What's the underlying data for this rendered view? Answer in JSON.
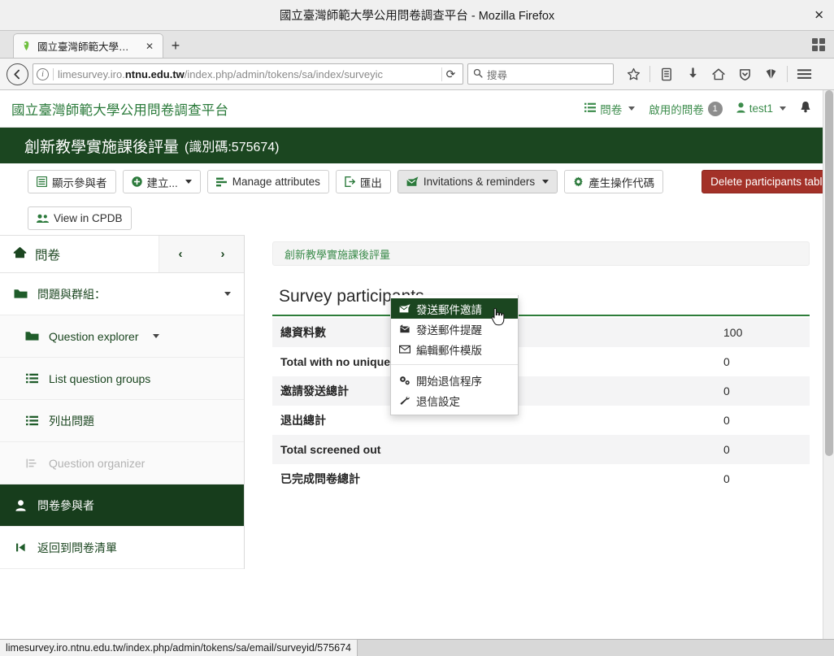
{
  "browser": {
    "window_title": "國立臺灣師範大學公用問卷調查平台 - Mozilla Firefox",
    "close_label": "✕",
    "tab_label": "國立臺灣師範大學公…",
    "tab_close": "✕",
    "new_tab": "+",
    "url_prefix": "limesurvey.iro.",
    "url_domain": "ntnu.edu.tw",
    "url_path": "/index.php/admin/tokens/sa/index/surveyic",
    "reload_glyph": "⟳",
    "search_placeholder": "搜尋",
    "search_icon": "search-icon",
    "status_url": "limesurvey.iro.ntnu.edu.tw/index.php/admin/tokens/sa/email/surveyid/575674"
  },
  "app": {
    "brand": "國立臺灣師範大學公用問卷調查平台",
    "nav": {
      "surveys_label": "問卷",
      "active_surveys_label": "啟用的問卷",
      "active_surveys_count": "1",
      "user_label": "test1",
      "bell_icon": "bell-icon"
    },
    "survey_bar": {
      "title": "創新教學實施課後評量",
      "code": "(識別碼:575674)"
    }
  },
  "toolbar": {
    "buttons": [
      {
        "label": "顯示參與者",
        "icon": "list-icon",
        "style": "default"
      },
      {
        "label": "建立...",
        "icon": "plus-circle-icon",
        "style": "default",
        "caret": true
      },
      {
        "label": "Manage attributes",
        "icon": "attributes-icon",
        "style": "default"
      },
      {
        "label": "匯出",
        "icon": "export-icon",
        "style": "default"
      },
      {
        "label": "Invitations & reminders",
        "icon": "mail-send-icon",
        "style": "active",
        "caret": true
      },
      {
        "label": "產生操作代碼",
        "icon": "gear-icon",
        "style": "default"
      },
      {
        "label": "View in CPDB",
        "icon": "users-icon",
        "style": "default"
      }
    ],
    "danger_button": {
      "label": "Delete participants table",
      "style": "danger"
    }
  },
  "dropdown": {
    "items": [
      {
        "label": "發送郵件邀請",
        "icon": "envelope-open-icon",
        "selected": true
      },
      {
        "label": "發送郵件提醒",
        "icon": "envelope-reply-icon",
        "selected": false
      },
      {
        "label": "編輯郵件模版",
        "icon": "envelope-icon",
        "selected": false
      },
      {
        "label": "開始退信程序",
        "icon": "cogs-icon",
        "selected": false,
        "after_separator": true
      },
      {
        "label": "退信設定",
        "icon": "wrench-icon",
        "selected": false
      }
    ]
  },
  "sidebar": {
    "header": {
      "label": "問卷",
      "icon": "home-icon",
      "prev": "‹",
      "next": "›"
    },
    "items": [
      {
        "label": "問題與群組：",
        "icon": "folder-open-icon",
        "state": "group",
        "caret": "right"
      },
      {
        "label": "Question explorer",
        "icon": "folder-open-icon",
        "state": "indent",
        "caret": "inline"
      },
      {
        "label": "List question groups",
        "icon": "list-icon",
        "state": "indent"
      },
      {
        "label": "列出問題",
        "icon": "list-icon",
        "state": "indent"
      },
      {
        "label": "Question organizer",
        "icon": "organizer-icon",
        "state": "disabled"
      },
      {
        "label": "問卷參與者",
        "icon": "user-icon",
        "state": "active"
      },
      {
        "label": "返回到問卷清單",
        "icon": "step-backward-icon",
        "state": "plain"
      }
    ]
  },
  "main": {
    "breadcrumb": "創新教學實施課後評量",
    "title": "Survey participants",
    "table": {
      "rows": [
        {
          "label": "總資料數",
          "value": "100"
        },
        {
          "label": "Total with no unique token",
          "value": "0"
        },
        {
          "label": "邀請發送總計",
          "value": "0"
        },
        {
          "label": "退出總計",
          "value": "0"
        },
        {
          "label": "Total screened out",
          "value": "0"
        },
        {
          "label": "已完成問卷總計",
          "value": "0"
        }
      ]
    }
  },
  "colors": {
    "brand_dark_green": "#1b4620",
    "brand_green": "#2e7d3a",
    "danger_red": "#a33128",
    "sidebar_active": "#173d1c"
  }
}
